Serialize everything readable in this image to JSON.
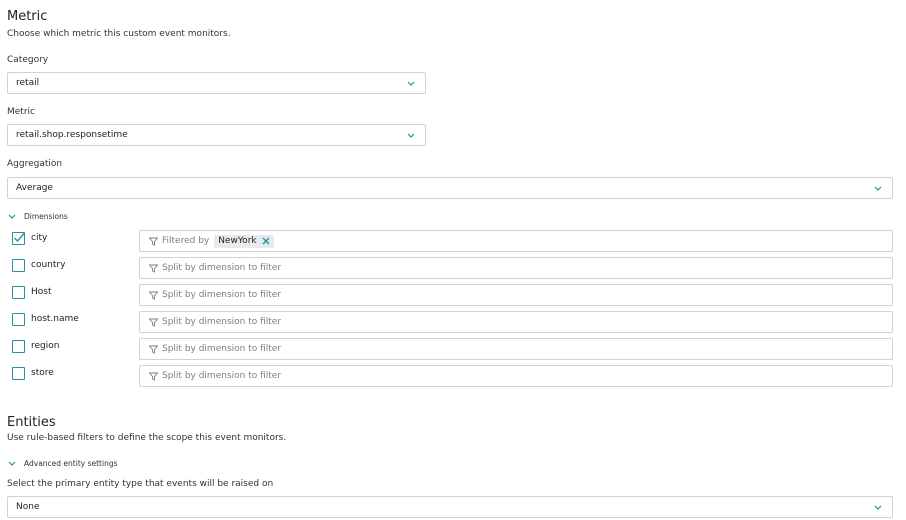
{
  "metric": {
    "title": "Metric",
    "description": "Choose which metric this custom event monitors.",
    "category": {
      "label": "Category",
      "value": "retail"
    },
    "metric_field": {
      "label": "Metric",
      "value": "retail.shop.responsetime"
    },
    "aggregation": {
      "label": "Aggregation",
      "value": "Average"
    },
    "dimensions": {
      "toggle_label": "Dimensions",
      "rows": [
        {
          "name": "city",
          "checked": true,
          "filter_prefix": "Filtered by",
          "chip": "NewYork"
        },
        {
          "name": "country",
          "checked": false,
          "placeholder": "Split by dimension to filter"
        },
        {
          "name": "Host",
          "checked": false,
          "placeholder": "Split by dimension to filter"
        },
        {
          "name": "host.name",
          "checked": false,
          "placeholder": "Split by dimension to filter"
        },
        {
          "name": "region",
          "checked": false,
          "placeholder": "Split by dimension to filter"
        },
        {
          "name": "store",
          "checked": false,
          "placeholder": "Split by dimension to filter"
        }
      ]
    }
  },
  "entities": {
    "title": "Entities",
    "description": "Use rule-based filters to define the scope this event monitors.",
    "advanced_toggle_label": "Advanced entity settings",
    "entity_type": {
      "label": "Select the primary entity type that events will be raised on",
      "value": "None"
    }
  },
  "colors": {
    "accent": "#2a8f9a",
    "border": "#cfd3d6",
    "chip_bg": "#e8ebed"
  },
  "icons": {
    "dropdown": "chevron-down-icon",
    "filter": "filter-icon",
    "remove": "close-icon",
    "check": "check-icon"
  }
}
